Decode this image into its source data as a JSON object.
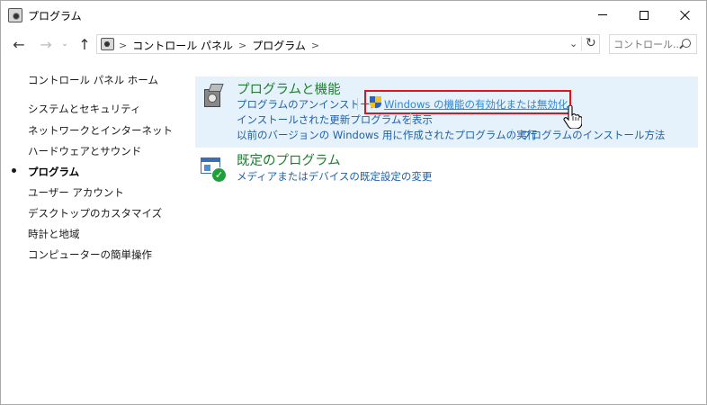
{
  "window": {
    "title": "プログラム"
  },
  "nav": {
    "back": "←",
    "forward": "→",
    "recent": "⌄",
    "up": "↑",
    "breadcrumbs": [
      "コントロール パネル",
      "プログラム"
    ],
    "crumb_sep": ">",
    "dropdown": "⌄",
    "refresh": "↻",
    "search_placeholder": "コントロール..."
  },
  "sidebar": {
    "home": "コントロール パネル ホーム",
    "items": [
      {
        "label": "システムとセキュリティ"
      },
      {
        "label": "ネットワークとインターネット"
      },
      {
        "label": "ハードウェアとサウンド"
      },
      {
        "label": "プログラム",
        "active": true
      },
      {
        "label": "ユーザー アカウント"
      },
      {
        "label": "デスクトップのカスタマイズ"
      },
      {
        "label": "時計と地域"
      },
      {
        "label": "コンピューターの簡単操作"
      }
    ]
  },
  "main": {
    "programs": {
      "title": "プログラムと機能",
      "links": {
        "uninstall": "プログラムのアンインストール",
        "windows_features": "Windows の機能の有効化または無効化",
        "installed_updates": "インストールされた更新プログラムを表示",
        "compat": "以前のバージョンの Windows 用に作成されたプログラムの実行",
        "how_to_install": "プログラムのインストール方法"
      }
    },
    "defaults": {
      "title": "既定のプログラム",
      "links": {
        "media_defaults": "メディアまたはデバイスの既定設定の変更"
      }
    }
  },
  "colors": {
    "section_title": "#1e7d2e",
    "link": "#1f5fa8",
    "highlight": "#e0141e",
    "panel_bg": "#e6f2fb"
  }
}
